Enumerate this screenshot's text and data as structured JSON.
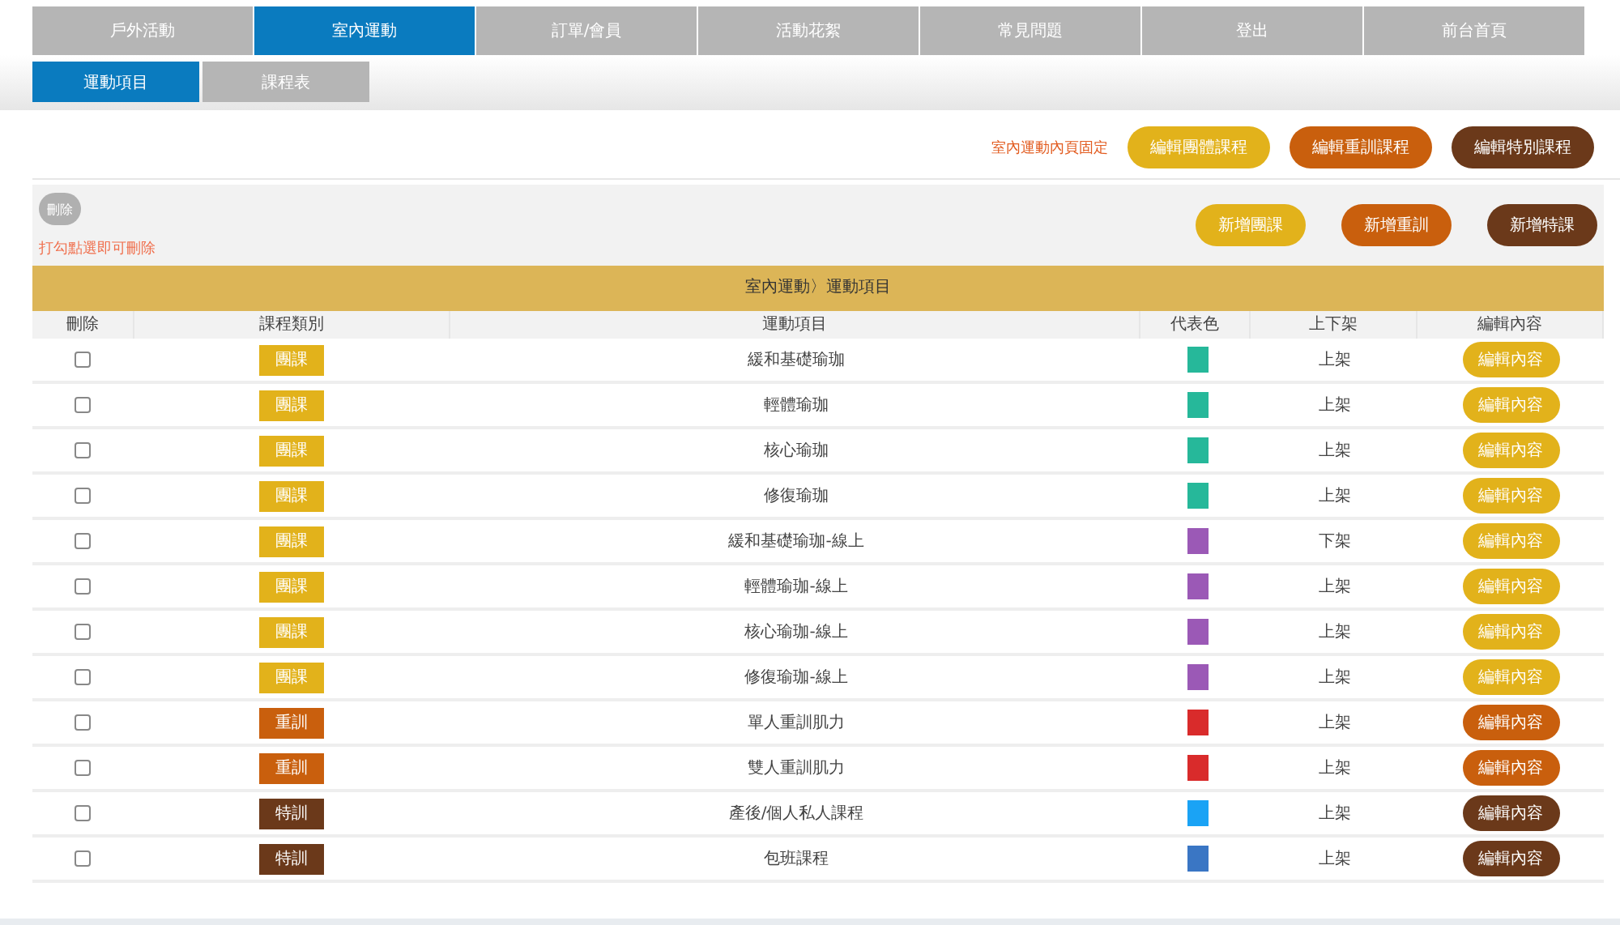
{
  "nav_tabs": [
    {
      "label": "戶外活動",
      "selected": false
    },
    {
      "label": "室內運動",
      "selected": true
    },
    {
      "label": "訂單/會員",
      "selected": false
    },
    {
      "label": "活動花絮",
      "selected": false
    },
    {
      "label": "常見問題",
      "selected": false
    },
    {
      "label": "登出",
      "selected": false
    },
    {
      "label": "前台首頁",
      "selected": false
    }
  ],
  "sub_tabs": [
    {
      "label": "運動項目",
      "selected": true
    },
    {
      "label": "課程表",
      "selected": false
    }
  ],
  "top_actions": {
    "note": "室內運動內頁固定",
    "buttons": [
      {
        "label": "編輯團體課程",
        "kind": "group"
      },
      {
        "label": "編輯重訓課程",
        "kind": "weight"
      },
      {
        "label": "編輯特別課程",
        "kind": "special"
      }
    ]
  },
  "toolbar": {
    "delete_button": "刪除",
    "hint": "打勾點選即可刪除",
    "buttons": [
      {
        "label": "新增團課",
        "kind": "group"
      },
      {
        "label": "新增重訓",
        "kind": "weight"
      },
      {
        "label": "新增特課",
        "kind": "special"
      }
    ]
  },
  "table": {
    "title": "室內運動〉運動項目",
    "columns": [
      "刪除",
      "課程類別",
      "運動項目",
      "代表色",
      "上下架",
      "編輯內容"
    ],
    "rows": [
      {
        "checked": false,
        "category": "團課",
        "kind": "group",
        "name": "緩和基礎瑜珈",
        "color": "#26b89a",
        "status": "上架",
        "edit": "編輯內容"
      },
      {
        "checked": false,
        "category": "團課",
        "kind": "group",
        "name": "輕體瑜珈",
        "color": "#26b89a",
        "status": "上架",
        "edit": "編輯內容"
      },
      {
        "checked": false,
        "category": "團課",
        "kind": "group",
        "name": "核心瑜珈",
        "color": "#26b89a",
        "status": "上架",
        "edit": "編輯內容"
      },
      {
        "checked": false,
        "category": "團課",
        "kind": "group",
        "name": "修復瑜珈",
        "color": "#26b89a",
        "status": "上架",
        "edit": "編輯內容"
      },
      {
        "checked": false,
        "category": "團課",
        "kind": "group",
        "name": "緩和基礎瑜珈-線上",
        "color": "#9b59b6",
        "status": "下架",
        "edit": "編輯內容"
      },
      {
        "checked": false,
        "category": "團課",
        "kind": "group",
        "name": "輕體瑜珈-線上",
        "color": "#9b59b6",
        "status": "上架",
        "edit": "編輯內容"
      },
      {
        "checked": false,
        "category": "團課",
        "kind": "group",
        "name": "核心瑜珈-線上",
        "color": "#9b59b6",
        "status": "上架",
        "edit": "編輯內容"
      },
      {
        "checked": false,
        "category": "團課",
        "kind": "group",
        "name": "修復瑜珈-線上",
        "color": "#9b59b6",
        "status": "上架",
        "edit": "編輯內容"
      },
      {
        "checked": false,
        "category": "重訓",
        "kind": "weight",
        "name": "單人重訓肌力",
        "color": "#d92b2b",
        "status": "上架",
        "edit": "編輯內容"
      },
      {
        "checked": false,
        "category": "重訓",
        "kind": "weight",
        "name": "雙人重訓肌力",
        "color": "#d92b2b",
        "status": "上架",
        "edit": "編輯內容"
      },
      {
        "checked": false,
        "category": "特訓",
        "kind": "special",
        "name": "產後/個人私人課程",
        "color": "#1aa3f5",
        "status": "上架",
        "edit": "編輯內容"
      },
      {
        "checked": false,
        "category": "特訓",
        "kind": "special",
        "name": "包班課程",
        "color": "#3a76c4",
        "status": "上架",
        "edit": "編輯內容"
      }
    ]
  }
}
